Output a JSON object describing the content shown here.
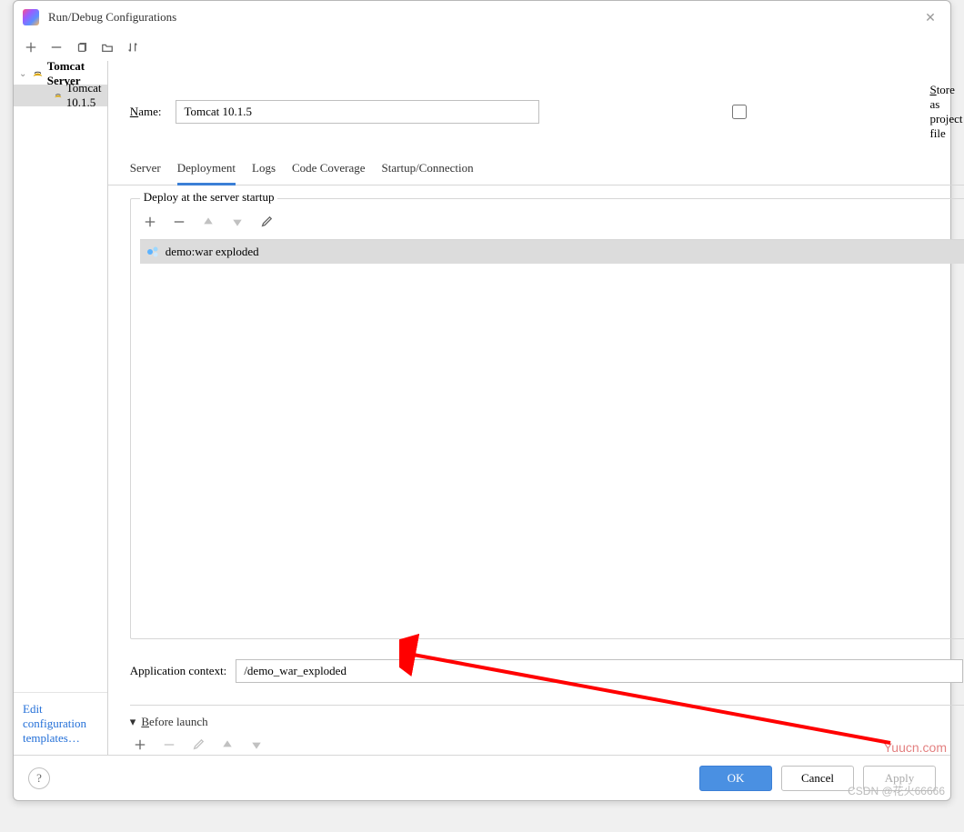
{
  "window": {
    "title": "Run/Debug Configurations"
  },
  "sidebar": {
    "root": {
      "label": "Tomcat Server"
    },
    "child": {
      "label": "Tomcat 10.1.5"
    },
    "footer_link": "Edit configuration templates…"
  },
  "form": {
    "name_label": "Name:",
    "name_value": "Tomcat 10.1.5",
    "store_label": "Store as project file"
  },
  "tabs": {
    "server": "Server",
    "deployment": "Deployment",
    "logs": "Logs",
    "coverage": "Code Coverage",
    "startup": "Startup/Connection"
  },
  "deploy": {
    "legend": "Deploy at the server startup",
    "artifact": "demo:war exploded"
  },
  "context": {
    "label": "Application context:",
    "value": "/demo_war_exploded"
  },
  "before": {
    "label": "Before launch"
  },
  "buttons": {
    "ok": "OK",
    "cancel": "Cancel",
    "apply": "Apply"
  },
  "watermark": "Yuucn.com",
  "credit": "CSDN @花火66666"
}
